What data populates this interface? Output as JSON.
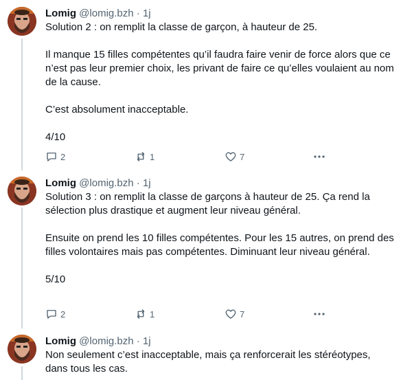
{
  "tweets": [
    {
      "name": "Lomig",
      "handle": "@lomig.bzh",
      "separator": "·",
      "time": "1j",
      "text": "Solution 2 : on remplit la classe de garçon, à hauteur de 25.\n\nIl manque 15 filles compétentes qu’il faudra faire venir de force alors que ce n’est pas leur premier choix, les privant de faire ce qu’elles voulaient au nom de la cause.\n\nC’est absolument inacceptable.\n\n4/10",
      "replies": "2",
      "retweets": "1",
      "likes": "7"
    },
    {
      "name": "Lomig",
      "handle": "@lomig.bzh",
      "separator": "·",
      "time": "1j",
      "text": "Solution 3 : on remplit la classe de garçons à hauteur de 25. Ça rend la sélection plus drastique et augment leur niveau général.\n\nEnsuite on prend les 10 filles compétentes. Pour les 15 autres, on prend des filles volontaires mais pas compétentes. Diminuant leur niveau général.\n\n5/10",
      "replies": "2",
      "retweets": "1",
      "likes": "7"
    },
    {
      "name": "Lomig",
      "handle": "@lomig.bzh",
      "separator": "·",
      "time": "1j",
      "text": "Non seulement c’est inacceptable, mais ça renforcerait les stéréotypes, dans tous les cas."
    }
  ],
  "colors": {
    "text": "#0f1419",
    "muted": "#536471",
    "thread_line": "#cfd9de"
  },
  "icons": [
    "reply-icon",
    "retweet-icon",
    "like-icon",
    "more-icon"
  ]
}
